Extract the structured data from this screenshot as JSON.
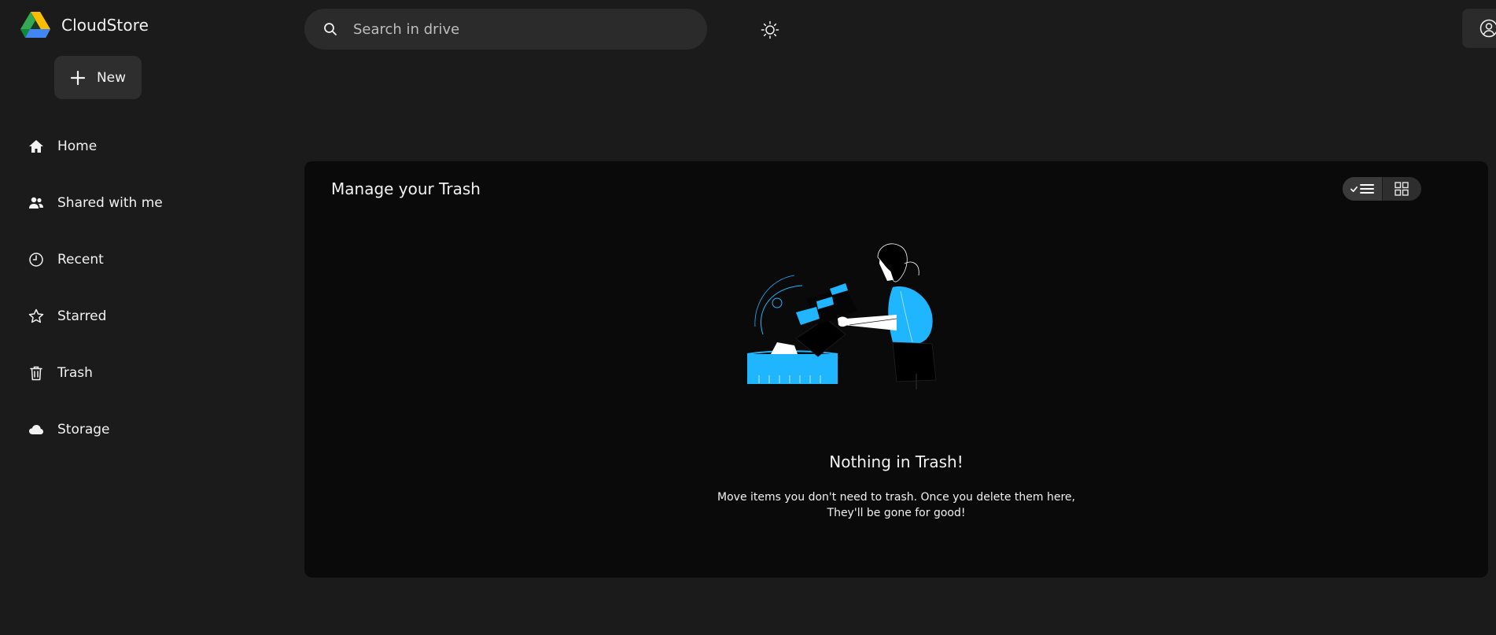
{
  "app": {
    "name": "CloudStore"
  },
  "sidebar": {
    "new_label": "New",
    "items": [
      {
        "label": "Home",
        "icon": "home-icon"
      },
      {
        "label": "Shared with me",
        "icon": "people-icon"
      },
      {
        "label": "Recent",
        "icon": "clock-icon"
      },
      {
        "label": "Starred",
        "icon": "star-icon"
      },
      {
        "label": "Trash",
        "icon": "trash-icon"
      },
      {
        "label": "Storage",
        "icon": "cloud-icon"
      }
    ]
  },
  "search": {
    "placeholder": "Search in drive",
    "value": ""
  },
  "header": {
    "theme_icon": "sun-icon",
    "account_icon": "account-icon"
  },
  "main": {
    "title": "Manage your Trash",
    "view_toggle": {
      "active": "list",
      "options": [
        "list",
        "grid"
      ]
    },
    "empty_state": {
      "title": "Nothing in Trash!",
      "line1": "Move items you don't need to trash. Once you delete them here,",
      "line2": "They'll be gone for good!"
    }
  },
  "colors": {
    "background": "#1b1b1b",
    "panel": "#0a0a0a",
    "accent": "#1fb6ff"
  }
}
